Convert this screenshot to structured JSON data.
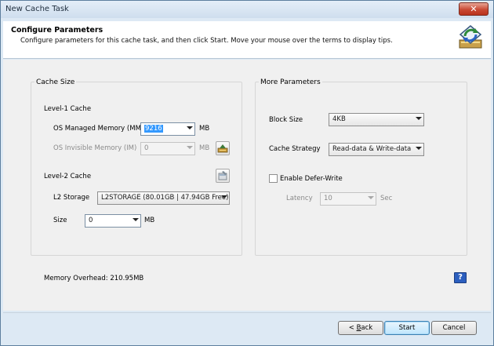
{
  "window": {
    "title": "New Cache Task",
    "close_glyph": "✕"
  },
  "header": {
    "title": "Configure Parameters",
    "subtitle": "Configure parameters for this cache task, and then click Start. Move your mouse over the terms to display tips.",
    "icon": "cache-wizard-icon"
  },
  "cache_size": {
    "title": "Cache Size",
    "level1": {
      "title": "Level-1 Cache",
      "os_managed_label": "OS Managed Memory (MM)",
      "os_managed_value": "9216",
      "os_managed_unit": "MB",
      "os_invisible_label": "OS Invisible Memory (IM)",
      "os_invisible_value": "0",
      "os_invisible_unit": "MB"
    },
    "level2": {
      "title": "Level-2 Cache",
      "storage_label": "L2 Storage",
      "storage_value": "L2STORAGE (80.01GB | 47.94GB Free)",
      "size_label": "Size",
      "size_value": "0",
      "size_unit": "MB"
    }
  },
  "more_params": {
    "title": "More Parameters",
    "block_size_label": "Block Size",
    "block_size_value": "4KB",
    "strategy_label": "Cache Strategy",
    "strategy_value": "Read-data & Write-data",
    "defer_write_label": "Enable Defer-Write",
    "defer_write_checked": false,
    "latency_label": "Latency",
    "latency_value": "10",
    "latency_unit": "Sec"
  },
  "memory_overhead": "Memory Overhead: 210.95MB",
  "help_glyph": "?",
  "buttons": {
    "back_prefix": "< ",
    "back_mnemonic": "B",
    "back_rest": "ack",
    "start": "Start",
    "cancel": "Cancel"
  }
}
